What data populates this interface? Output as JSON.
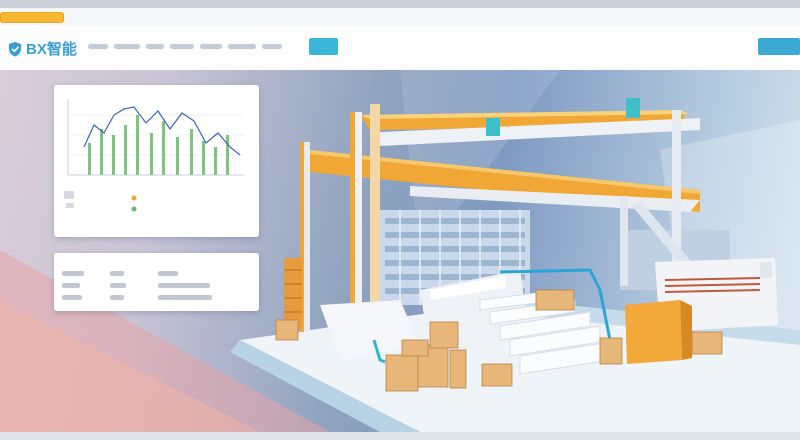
{
  "header": {
    "logo_text": "BX智能",
    "search_button": "",
    "login_button": "",
    "tab_label": ""
  },
  "icons": {
    "logo": "shield-icon",
    "card_bullet": "coin-icon"
  },
  "colors": {
    "accent": "#3bb6d6",
    "tab": "#f7b733",
    "chart_line": "#3b63b8",
    "chart_bar": "#6fb574",
    "orange_beam": "#f0a736"
  },
  "chart_card": {
    "legend_label": "",
    "values_line": ""
  },
  "stat_card": {
    "labels": [
      "",
      "",
      ""
    ],
    "values": [
      "",
      "",
      ""
    ]
  }
}
